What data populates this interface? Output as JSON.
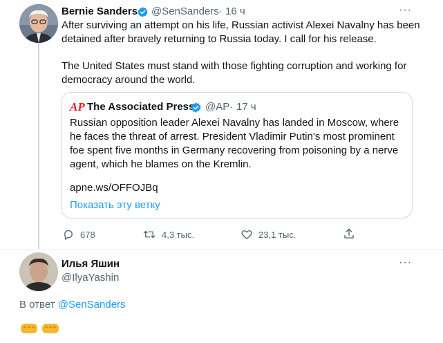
{
  "tweet": {
    "author_name": "Bernie Sanders",
    "author_handle": "@SenSanders",
    "separator": "·",
    "time": "16 ч",
    "paragraph1": "After surviving an attempt on his life, Russian activist Alexei Navalny has been detained after bravely returning to Russia today. I call for his release.",
    "paragraph2": "The United States must stand with those fighting corruption and working for democracy around the world.",
    "more_icon": "more-dots-icon",
    "quote": {
      "logo_text": "AP",
      "author_name": "The Associated Press",
      "author_handle": "@AP",
      "separator": "·",
      "time": "17 ч",
      "text": "Russian opposition leader Alexei Navalny has landed in Moscow, where he faces the threat of arrest. President Vladimir Putin's most prominent foe spent five months in Germany recovering from poisoning by a nerve agent, which he blames on the Kremlin.",
      "link": "apne.ws/OFFOJBq",
      "show_thread": "Показать эту ветку"
    },
    "actions": {
      "reply_count": "678",
      "retweet_count": "4,3 тыс.",
      "like_count": "23,1 тыс."
    }
  },
  "reply": {
    "author_name": "Илья Яшин",
    "author_handle": "@IlyaYashin",
    "reply_prefix": "В ответ",
    "reply_mention": "@SenSanders",
    "emoji_text": "👊👊"
  },
  "colors": {
    "accent": "#1d9bf0",
    "secondary_text": "#536471",
    "border": "#cfd9de",
    "verified": "#1d9bf0"
  }
}
